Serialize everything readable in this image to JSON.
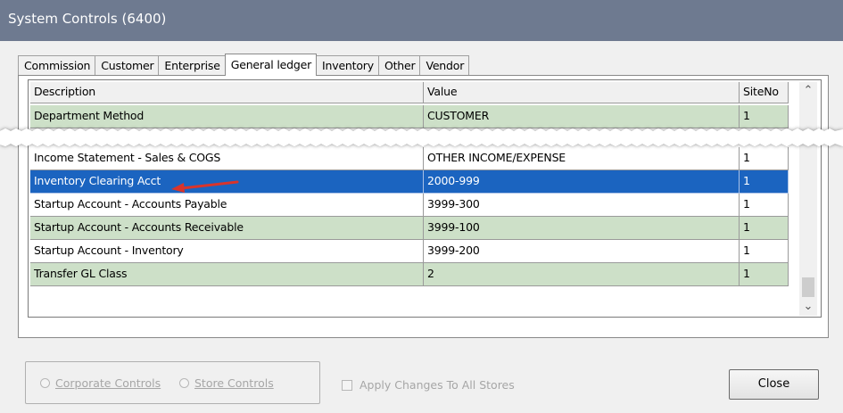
{
  "window": {
    "title": "System Controls (6400)"
  },
  "tabs": [
    {
      "label": "Commission"
    },
    {
      "label": "Customer"
    },
    {
      "label": "Enterprise"
    },
    {
      "label": "General ledger",
      "active": true
    },
    {
      "label": "Inventory"
    },
    {
      "label": "Other"
    },
    {
      "label": "Vendor"
    }
  ],
  "grid": {
    "columns": [
      "Description",
      "Value",
      "SiteNo"
    ],
    "rows": [
      {
        "description": "Department Method",
        "value": "CUSTOMER",
        "site": "1",
        "style": "green"
      },
      {
        "description": "Income Statement - Sales & COGS",
        "value": "OTHER INCOME/EXPENSE",
        "site": "1",
        "style": "white"
      },
      {
        "description": "Inventory Clearing Acct",
        "value": "2000-999",
        "site": "1",
        "style": "selected"
      },
      {
        "description": "Startup Account - Accounts Payable",
        "value": "3999-300",
        "site": "1",
        "style": "white"
      },
      {
        "description": "Startup Account - Accounts Receivable",
        "value": "3999-100",
        "site": "1",
        "style": "green"
      },
      {
        "description": "Startup Account - Inventory",
        "value": "3999-200",
        "site": "1",
        "style": "white"
      },
      {
        "description": "Transfer GL Class",
        "value": "2",
        "site": "1",
        "style": "green"
      }
    ]
  },
  "scrollbar": {
    "up_icon": "chevron-up-icon",
    "down_icon": "chevron-down-icon"
  },
  "footer": {
    "corporate_controls": "Corporate Controls",
    "store_controls": "Store Controls",
    "apply_all": "Apply Changes To All Stores",
    "close": "Close"
  },
  "colors": {
    "title_bar": "#6e7a90",
    "green_row": "#cde0c8",
    "selected_row": "#1b64c0",
    "arrow": "#d9342b"
  }
}
